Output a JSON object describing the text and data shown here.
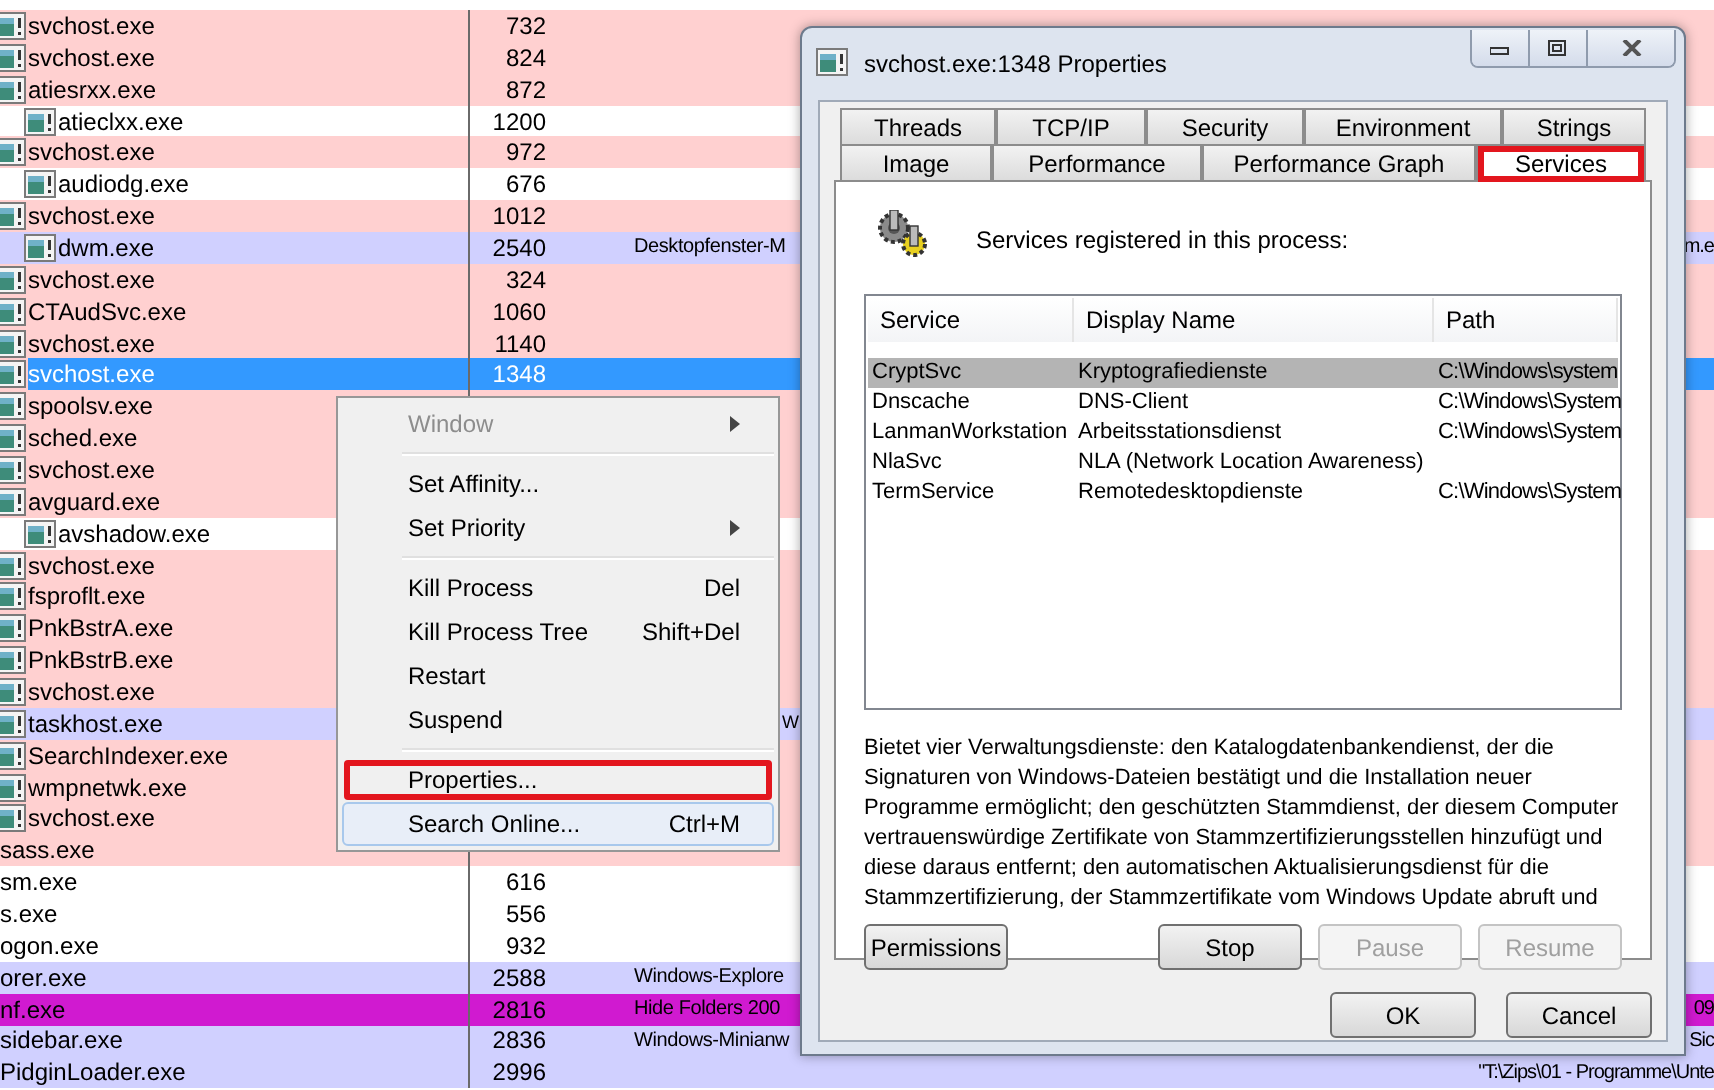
{
  "process_list": {
    "rows": [
      {
        "kind": "process",
        "name": "svchost.exe",
        "pid": "732",
        "color": "#ffd0d0",
        "selected": false
      },
      {
        "kind": "process",
        "name": "svchost.exe",
        "pid": "824",
        "color": "#ffd0d0",
        "selected": false
      },
      {
        "kind": "process",
        "name": "atiesrxx.exe",
        "pid": "872",
        "color": "#ffd0d0",
        "selected": false,
        "children": [
          {
            "kind": "process",
            "name": "atieclxx.exe",
            "pid": "1200",
            "color": "#ffffff",
            "selected": false
          }
        ]
      },
      {
        "kind": "process",
        "name": "svchost.exe",
        "pid": "972",
        "color": "#ffd0d0",
        "selected": false,
        "children": [
          {
            "kind": "process",
            "name": "audiodg.exe",
            "pid": "676",
            "color": "#ffffff",
            "selected": false
          }
        ]
      },
      {
        "kind": "process",
        "name": "svchost.exe",
        "pid": "1012",
        "color": "#ffd0d0",
        "selected": false,
        "children": [
          {
            "kind": "process",
            "name": "dwm.exe",
            "pid": "2540",
            "color": "#d0d0ff",
            "selected": false,
            "column_3": "Desktopfenster-M",
            "column_4": "m.e"
          }
        ]
      },
      {
        "kind": "process",
        "name": "svchost.exe",
        "pid": "324",
        "color": "#ffd0d0",
        "selected": false
      },
      {
        "kind": "process",
        "name": "CTAudSvc.exe",
        "pid": "1060",
        "color": "#ffd0d0",
        "selected": false
      },
      {
        "kind": "process",
        "name": "svchost.exe",
        "pid": "1140",
        "color": "#ffd0d0",
        "selected": false
      },
      {
        "kind": "process",
        "name": "svchost.exe",
        "pid": "1348",
        "color": "#ffd0d0",
        "selected": true
      },
      {
        "kind": "process",
        "name": "spoolsv.exe",
        "color": "#ffd0d0",
        "selected": false
      },
      {
        "kind": "process",
        "name": "sched.exe",
        "color": "#ffd0d0",
        "selected": false
      },
      {
        "kind": "process",
        "name": "svchost.exe",
        "color": "#ffd0d0",
        "selected": false
      },
      {
        "kind": "process",
        "name": "avguard.exe",
        "color": "#ffd0d0",
        "selected": false,
        "children": [
          {
            "kind": "process",
            "name": "avshadow.exe",
            "color": "#ffffff",
            "selected": false
          }
        ]
      },
      {
        "kind": "process",
        "name": "svchost.exe",
        "color": "#ffd0d0",
        "selected": false
      },
      {
        "kind": "process",
        "name": "fsproflt.exe",
        "color": "#ffd0d0",
        "selected": false
      },
      {
        "kind": "process",
        "name": "PnkBstrA.exe",
        "color": "#ffd0d0",
        "selected": false
      },
      {
        "kind": "process",
        "name": "PnkBstrB.exe",
        "color": "#ffd0d0",
        "selected": false
      },
      {
        "kind": "process",
        "name": "svchost.exe",
        "color": "#ffd0d0",
        "selected": false
      },
      {
        "kind": "process",
        "name": "taskhost.exe",
        "color": "#d0d0ff",
        "selected": false,
        "column_3_fragment": "W"
      },
      {
        "kind": "process",
        "name": "SearchIndexer.exe",
        "color": "#ffd0d0",
        "selected": false
      },
      {
        "kind": "process",
        "name": "wmpnetwk.exe",
        "color": "#ffd0d0",
        "selected": false
      },
      {
        "kind": "process",
        "name": "svchost.exe",
        "color": "#ffd0d0",
        "selected": false
      },
      {
        "kind": "clipped",
        "name": "sass.exe",
        "color": "#ffd0d0",
        "selected": false
      },
      {
        "kind": "clipped",
        "name": "sm.exe",
        "pid": "616",
        "color": "#ffffff",
        "selected": false
      },
      {
        "kind": "clipped",
        "name": "s.exe",
        "pid": "556",
        "color": "#ffffff",
        "selected": false
      },
      {
        "kind": "clipped",
        "name": "ogon.exe",
        "pid": "932",
        "color": "#ffffff",
        "selected": false
      },
      {
        "kind": "clipped",
        "name": "orer.exe",
        "pid": "2588",
        "color": "#d0d0ff",
        "selected": false,
        "column_3": "Windows-Explore"
      },
      {
        "kind": "clipped",
        "name": "nf.exe",
        "pid": "2816",
        "color": "#d01ad0",
        "selected": false,
        "column_3": "Hide Folders 200",
        "column_4": "09"
      },
      {
        "kind": "clipped",
        "name": "sidebar.exe",
        "pid": "2836",
        "color": "#d0d0ff",
        "selected": false,
        "column_3": "Windows-Minianw",
        "column_4": "Sic"
      },
      {
        "kind": "clipped",
        "name": "PidginLoader.exe",
        "pid": "2996",
        "color": "#d0d0ff",
        "selected": false,
        "column_4": "\"T:\\Zips\\01 - Programme\\Unte"
      }
    ]
  },
  "context_menu": {
    "items": [
      {
        "kind": "item",
        "label": "Window",
        "disabled": true,
        "submenu": true,
        "highlighted": false,
        "annotated": false
      },
      {
        "kind": "separator"
      },
      {
        "kind": "item",
        "label": "Set Affinity...",
        "disabled": false,
        "submenu": false,
        "highlighted": false,
        "annotated": false
      },
      {
        "kind": "item",
        "label": "Set Priority",
        "disabled": false,
        "submenu": true,
        "highlighted": false,
        "annotated": false
      },
      {
        "kind": "separator"
      },
      {
        "kind": "item",
        "label": "Kill Process",
        "shortcut": "Del",
        "disabled": false,
        "submenu": false,
        "highlighted": false,
        "annotated": false
      },
      {
        "kind": "item",
        "label": "Kill Process Tree",
        "shortcut": "Shift+Del",
        "disabled": false,
        "submenu": false,
        "highlighted": false,
        "annotated": false
      },
      {
        "kind": "item",
        "label": "Restart",
        "disabled": false,
        "submenu": false,
        "highlighted": false,
        "annotated": false
      },
      {
        "kind": "item",
        "label": "Suspend",
        "disabled": false,
        "submenu": false,
        "highlighted": false,
        "annotated": false
      },
      {
        "kind": "separator"
      },
      {
        "kind": "item",
        "label": "Properties...",
        "disabled": false,
        "submenu": false,
        "highlighted": false,
        "annotated": true
      },
      {
        "kind": "item",
        "label": "Search Online...",
        "shortcut": "Ctrl+M",
        "disabled": false,
        "submenu": false,
        "highlighted": true,
        "annotated": false
      }
    ]
  },
  "dialog": {
    "title": "svchost.exe:1348 Properties",
    "tab_rows": [
      {
        "tabs": [
          {
            "label": "Threads",
            "selected": false,
            "annotated": false
          },
          {
            "label": "TCP/IP",
            "selected": false,
            "annotated": false
          },
          {
            "label": "Security",
            "selected": false,
            "annotated": false
          },
          {
            "label": "Environment",
            "selected": false,
            "annotated": false
          },
          {
            "label": "Strings",
            "selected": false,
            "annotated": false
          }
        ]
      },
      {
        "tabs": [
          {
            "label": "Image",
            "selected": false,
            "annotated": false
          },
          {
            "label": "Performance",
            "selected": false,
            "annotated": false
          },
          {
            "label": "Performance Graph",
            "selected": false,
            "annotated": false
          },
          {
            "label": "Services",
            "selected": true,
            "annotated": true
          }
        ]
      }
    ],
    "heading": "Services registered in this process:",
    "services": {
      "columns": [
        "Service",
        "Display Name",
        "Path"
      ],
      "rows": [
        {
          "service": "CryptSvc",
          "display_name": "Kryptografiedienste",
          "path": "C:\\Windows\\system",
          "selected": true
        },
        {
          "service": "Dnscache",
          "display_name": "DNS-Client",
          "path": "C:\\Windows\\System",
          "selected": false
        },
        {
          "service": "LanmanWorkstation",
          "display_name": "Arbeitsstationsdienst",
          "path": "C:\\Windows\\System",
          "selected": false
        },
        {
          "service": "NlaSvc",
          "display_name": "NLA (Network Location Awareness)",
          "selected": false
        },
        {
          "service": "TermService",
          "display_name": "Remotedesktopdienste",
          "path": "C:\\Windows\\System",
          "selected": false
        }
      ]
    },
    "description": "Bietet vier Verwaltungsdienste: den Katalogdatenbankendienst, der die Signaturen von Windows-Dateien bestätigt und die Installation neuer Programme ermöglicht; den geschützten Stammdienst, der diesem Computer vertrauenswürdige Zertifikate von Stammzertifizierungsstellen hinzufügt und diese daraus entfernt; den automatischen Aktualisierungsdienst für die Stammzertifizierung, der Stammzertifikate vom Windows Update abruft und",
    "service_buttons": [
      {
        "label": "Permissions",
        "disabled": false
      },
      {
        "label": "Stop",
        "disabled": false
      },
      {
        "label": "Pause",
        "disabled": true
      },
      {
        "label": "Resume",
        "disabled": true
      }
    ],
    "footer_buttons": [
      {
        "label": "OK"
      },
      {
        "label": "Cancel"
      }
    ]
  }
}
